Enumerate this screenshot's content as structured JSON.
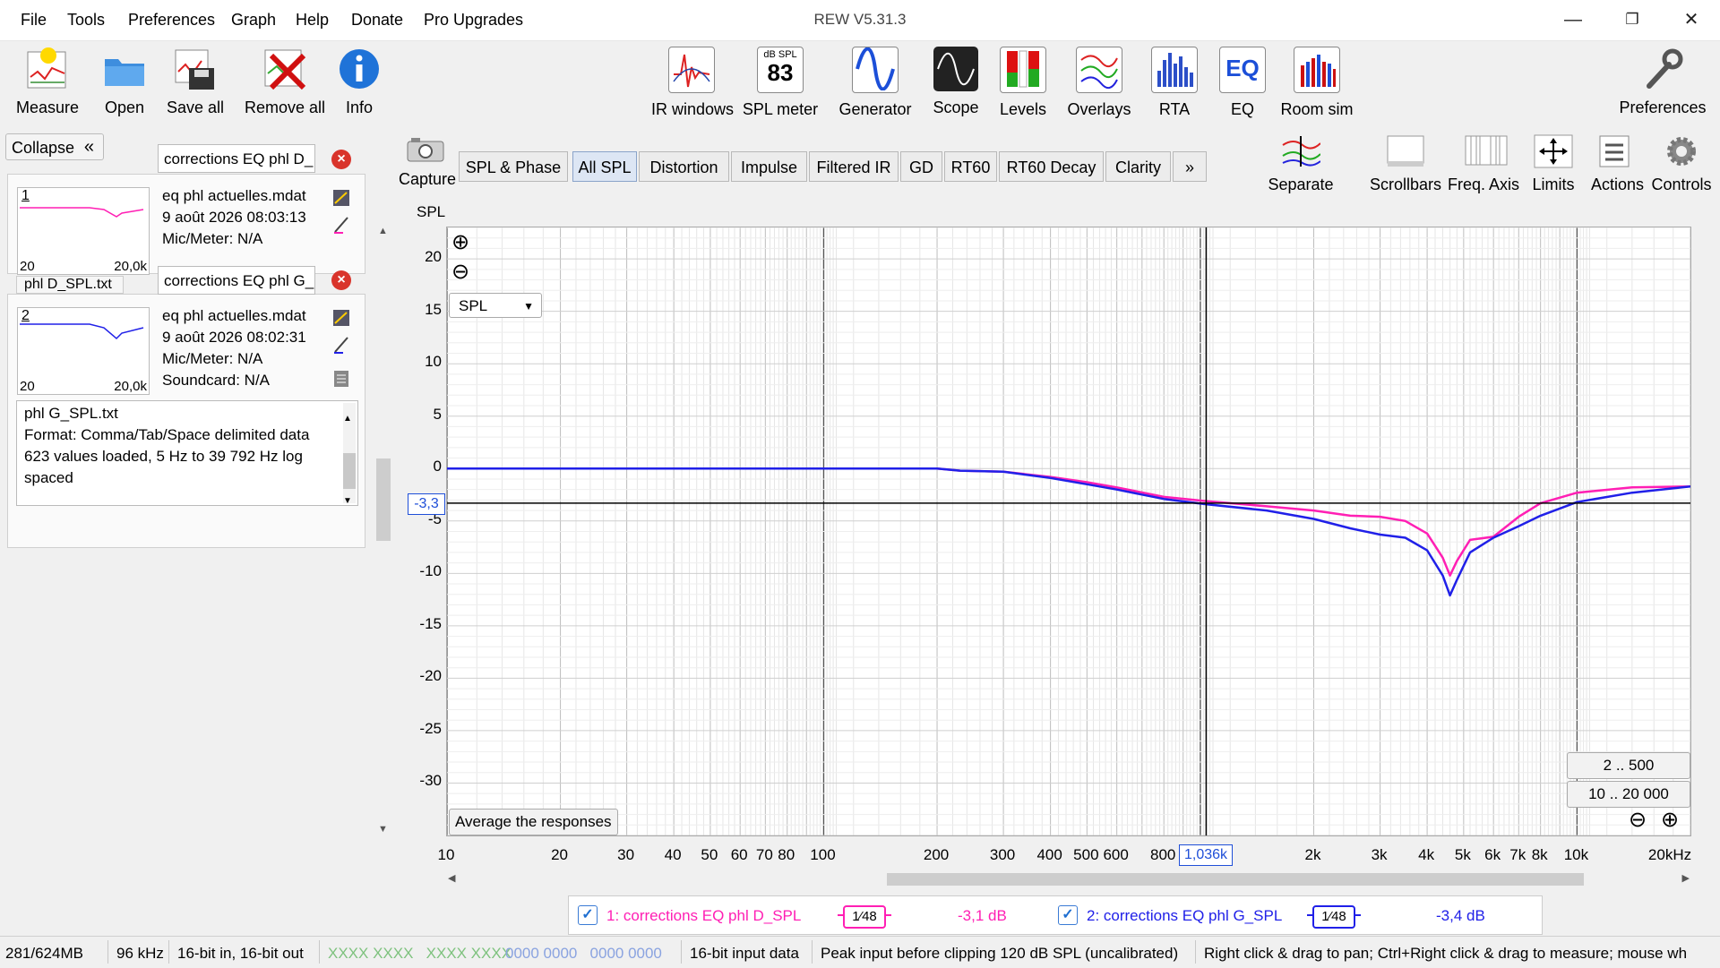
{
  "menu": [
    "File",
    "Tools",
    "Preferences",
    "Graph",
    "Help",
    "Donate",
    "Pro Upgrades"
  ],
  "window_title": "REW V5.31.3",
  "window_controls": {
    "minimize": "—",
    "maximize": "❐",
    "close": "✕"
  },
  "toolbar_left": [
    "Measure",
    "Open",
    "Save all",
    "Remove all",
    "Info"
  ],
  "toolbar_center": [
    "IR windows",
    "SPL meter",
    "Generator",
    "Scope",
    "Levels",
    "Overlays",
    "RTA",
    "EQ",
    "Room sim"
  ],
  "spl_meter_icon": {
    "unit": "dB SPL",
    "value": "83"
  },
  "eq_icon_text": "EQ",
  "toolbar_right": "Preferences",
  "collapse_label": "Collapse",
  "collapse_icon": "«",
  "measurements": [
    {
      "name": "corrections EQ phl D_",
      "index": "1",
      "file": "eq phl actuelles.mdat",
      "date": "9 août 2026 08:03:13",
      "mic": "Mic/Meter: N/A",
      "thumb_start": "20",
      "thumb_end": "20,0k",
      "tab_label": "phl D_SPL.txt",
      "color": "#ff1fb4"
    },
    {
      "name": "corrections EQ phl G_",
      "index": "2",
      "file": "eq phl actuelles.mdat",
      "date": "9 août 2026 08:02:31",
      "mic": "Mic/Meter: N/A",
      "soundcard": "Soundcard: N/A",
      "thumb_start": "20",
      "thumb_end": "20,0k",
      "color": "#2020e8"
    }
  ],
  "info_box": [
    "phl G_SPL.txt",
    "Format: Comma/Tab/Space delimited data",
    "623 values loaded, 5 Hz to 39 792 Hz log",
    "spaced"
  ],
  "capture_label": "Capture",
  "graph_tabs": [
    "SPL & Phase",
    "All SPL",
    "Distortion",
    "Impulse",
    "Filtered IR",
    "GD",
    "RT60",
    "RT60 Decay",
    "Clarity",
    "»"
  ],
  "active_tab": "All SPL",
  "right_tools": [
    "Separate",
    "Scrollbars",
    "Freq. Axis",
    "Limits",
    "Actions",
    "Controls"
  ],
  "y_axis_label": "SPL",
  "y_ticks": [
    "20",
    "15",
    "10",
    "5",
    "0",
    "-5",
    "-10",
    "-15",
    "-20",
    "-25",
    "-30"
  ],
  "x_ticks": [
    "10",
    "20",
    "30",
    "40",
    "50",
    "60",
    "70",
    "80",
    "100",
    "200",
    "300",
    "400",
    "500",
    "600",
    "800",
    "2k",
    "3k",
    "4k",
    "5k",
    "6k",
    "7k",
    "8k",
    "10k",
    "20kHz"
  ],
  "spl_select": "SPL",
  "zoom_in_icon": "⊕",
  "zoom_out_icon": "⊖",
  "cursor": {
    "freq": "1,036k",
    "level": "-3,3"
  },
  "average_button": "Average the responses",
  "range_buttons": [
    "2 .. 500",
    "10 .. 20 000"
  ],
  "legend": [
    {
      "checked": "✓",
      "name": "1: corrections EQ phl D_SPL",
      "smoothing": "1⁄48",
      "value": "-3,1 dB",
      "color": "#ff1fb4"
    },
    {
      "checked": "✓",
      "name": "2: corrections EQ phl G_SPL",
      "smoothing": "1⁄48",
      "value": "-3,4 dB",
      "color": "#2020e8"
    }
  ],
  "status": {
    "memory": "281/624MB",
    "rate": "96 kHz",
    "bits": "16-bit in, 16-bit out",
    "in_levels": "XXXX XXXX   XXXX XXXX",
    "out_levels": "0000 0000   0000 0000",
    "input_data": "16-bit input data",
    "peak": "Peak input before clipping 120 dB SPL (uncalibrated)",
    "hint": "Right click & drag to pan; Ctrl+Right click & drag to measure; mouse wh"
  },
  "chart_data": {
    "type": "line",
    "ylabel": "SPL",
    "xlabel": "",
    "xscale": "log",
    "xlim": [
      10,
      20000
    ],
    "ylim": [
      -35,
      23
    ],
    "grid": true,
    "series": [
      {
        "name": "1: corrections EQ phl D_SPL",
        "color": "#ff1fb4",
        "points": [
          [
            10,
            0
          ],
          [
            100,
            0
          ],
          [
            200,
            0
          ],
          [
            230,
            -0.2
          ],
          [
            300,
            -0.3
          ],
          [
            400,
            -0.8
          ],
          [
            500,
            -1.3
          ],
          [
            600,
            -1.8
          ],
          [
            800,
            -2.7
          ],
          [
            1036,
            -3.1
          ],
          [
            1500,
            -3.6
          ],
          [
            2000,
            -4.0
          ],
          [
            2500,
            -4.5
          ],
          [
            3000,
            -4.6
          ],
          [
            3500,
            -5.0
          ],
          [
            4000,
            -6.2
          ],
          [
            4400,
            -8.5
          ],
          [
            4600,
            -10.2
          ],
          [
            4800,
            -8.8
          ],
          [
            5200,
            -6.8
          ],
          [
            6000,
            -6.5
          ],
          [
            7000,
            -4.6
          ],
          [
            8000,
            -3.3
          ],
          [
            10000,
            -2.3
          ],
          [
            14000,
            -1.8
          ],
          [
            20000,
            -1.7
          ]
        ]
      },
      {
        "name": "2: corrections EQ phl G_SPL",
        "color": "#2020e8",
        "points": [
          [
            10,
            0
          ],
          [
            100,
            0
          ],
          [
            200,
            0
          ],
          [
            230,
            -0.2
          ],
          [
            300,
            -0.3
          ],
          [
            400,
            -0.9
          ],
          [
            500,
            -1.5
          ],
          [
            600,
            -2.0
          ],
          [
            800,
            -2.9
          ],
          [
            1036,
            -3.4
          ],
          [
            1500,
            -4.0
          ],
          [
            2000,
            -4.8
          ],
          [
            2500,
            -5.7
          ],
          [
            3000,
            -6.3
          ],
          [
            3500,
            -6.6
          ],
          [
            4000,
            -7.8
          ],
          [
            4400,
            -10.2
          ],
          [
            4600,
            -12.1
          ],
          [
            4800,
            -10.6
          ],
          [
            5200,
            -8.0
          ],
          [
            6000,
            -6.6
          ],
          [
            7000,
            -5.5
          ],
          [
            8000,
            -4.5
          ],
          [
            10000,
            -3.2
          ],
          [
            14000,
            -2.3
          ],
          [
            20000,
            -1.7
          ]
        ]
      }
    ]
  }
}
